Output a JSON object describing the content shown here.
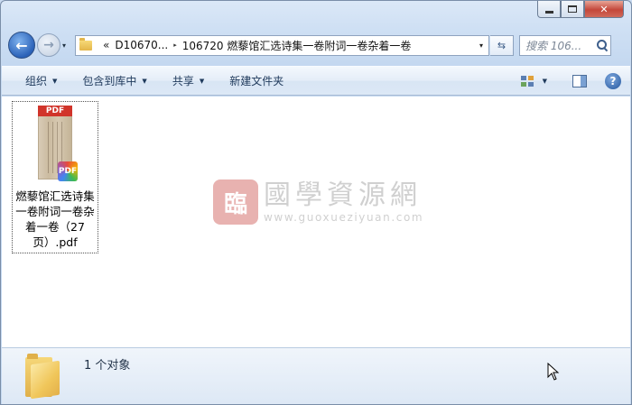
{
  "window": {
    "caption_buttons": [
      "minimize-icon",
      "maximize-icon",
      "close-icon"
    ],
    "close_glyph": "✕"
  },
  "address_bar": {
    "chevron": "«",
    "crumbs": [
      "D10670...",
      "106720 燃藜馆汇选诗集一卷附词一卷杂着一卷"
    ],
    "separator": "▸",
    "dropdown_glyph": "▾",
    "refresh_glyph": "⇆",
    "search_placeholder": "搜索 106..."
  },
  "nav": {
    "back_glyph": "←",
    "forward_glyph": "→",
    "history_glyph": "▾"
  },
  "command_bar": {
    "items": [
      {
        "label": "组织",
        "has_dropdown": true
      },
      {
        "label": "包含到库中",
        "has_dropdown": true
      },
      {
        "label": "共享",
        "has_dropdown": true
      },
      {
        "label": "新建文件夹",
        "has_dropdown": false
      }
    ],
    "dropdown_glyph": "▼",
    "help_glyph": "?"
  },
  "content": {
    "files": [
      {
        "name": "燃藜馆汇选诗集一卷附词一卷杂着一卷（27页）.pdf",
        "thumb_banner": "PDF",
        "badge": "PDF",
        "icon": "pdf-file-icon"
      }
    ],
    "watermark": {
      "seal": "臨",
      "title": "國學資源網",
      "url": "www.guoxueziyuan.com"
    }
  },
  "details_pane": {
    "count_text": "1 个对象",
    "icon": "folder-icon"
  },
  "colors": {
    "accent": "#1e395b",
    "close_button": "#c4473a",
    "pdf_red": "#d1342a"
  }
}
